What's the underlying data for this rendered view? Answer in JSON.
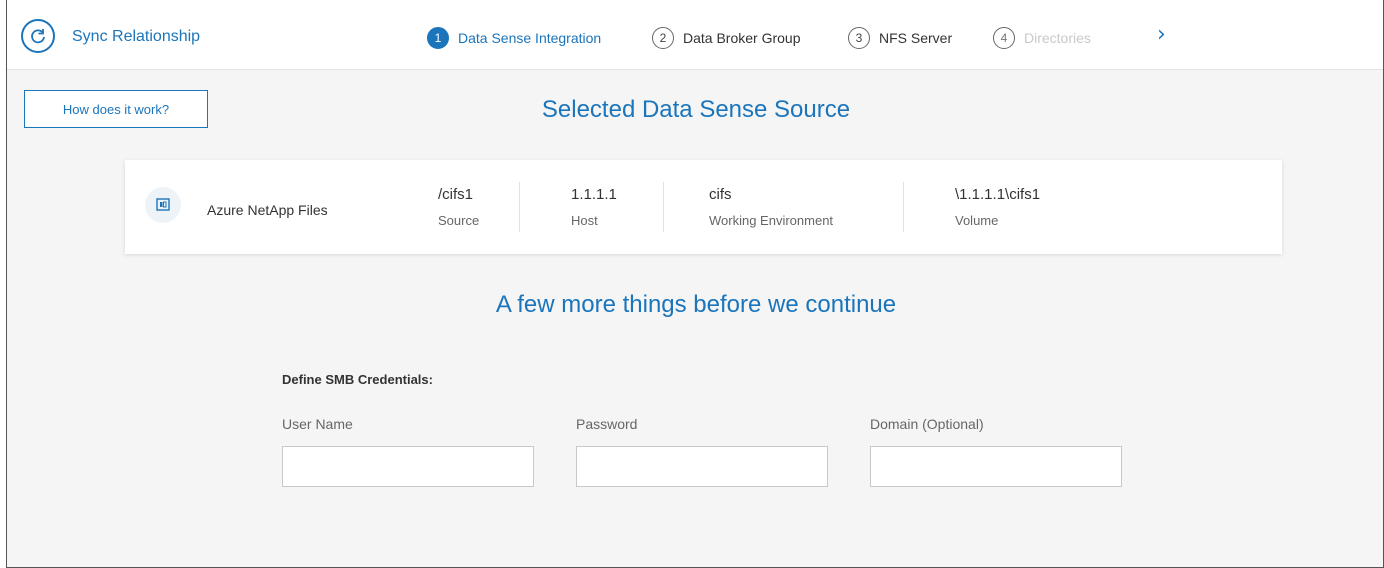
{
  "header": {
    "title": "Sync Relationship",
    "steps": [
      {
        "num": "1",
        "label": "Data Sense Integration"
      },
      {
        "num": "2",
        "label": "Data Broker Group"
      },
      {
        "num": "3",
        "label": "NFS Server"
      },
      {
        "num": "4",
        "label": "Directories"
      }
    ],
    "next_arrow": "›"
  },
  "help_button": "How does it work?",
  "selected_source": {
    "title": "Selected Data Sense Source",
    "provider": "Azure NetApp Files",
    "source_value": "/cifs1",
    "source_label": "Source",
    "host_value": "1.1.1.1",
    "host_label": "Host",
    "env_value": "cifs",
    "env_label": "Working Environment",
    "volume_value": "\\1.1.1.1\\cifs1",
    "volume_label": "Volume"
  },
  "more_title": "A few more things before we continue",
  "credentials": {
    "title": "Define SMB Credentials:",
    "user_label": "User Name",
    "user_value": "",
    "password_label": "Password",
    "password_value": "",
    "domain_label": "Domain (Optional)",
    "domain_value": ""
  },
  "colors": {
    "accent": "#1b75bb",
    "background": "#f5f5f5"
  },
  "icons": {
    "sync": "sync-icon",
    "provider": "azure-netapp-files-icon"
  }
}
